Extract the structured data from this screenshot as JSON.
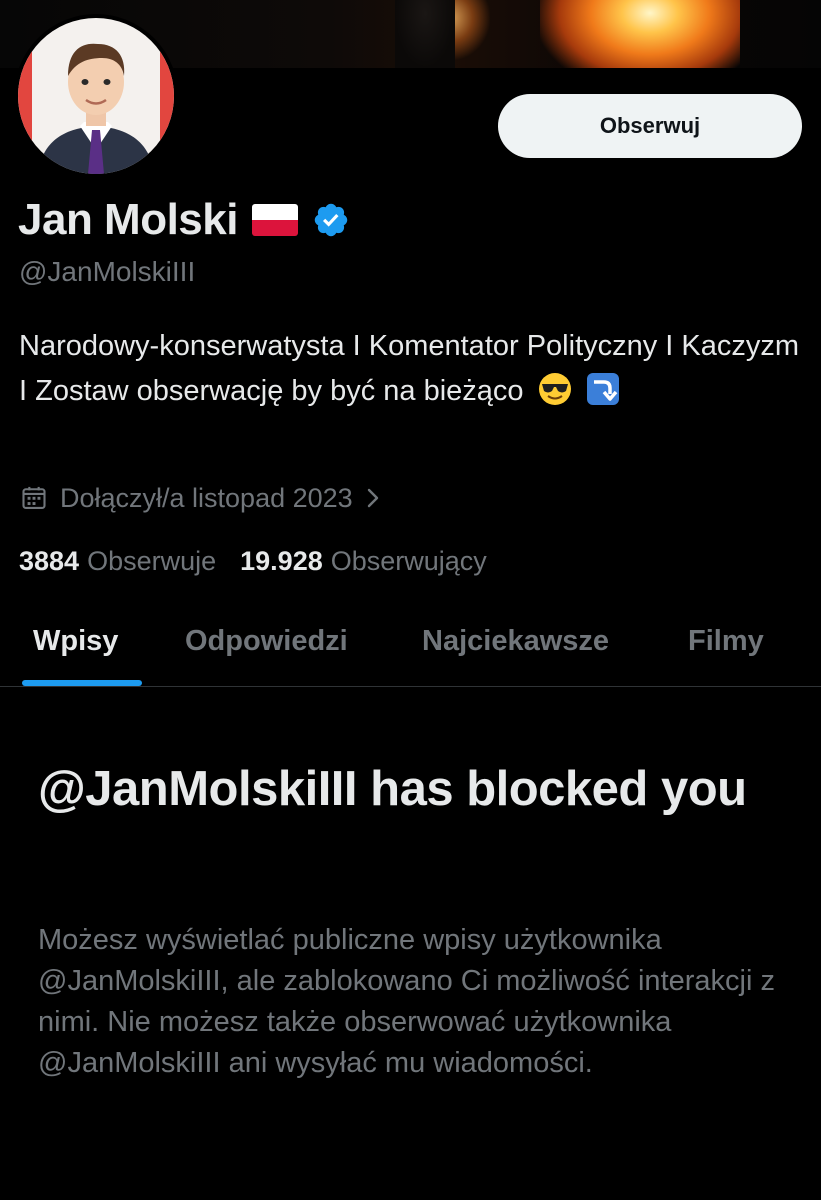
{
  "profile": {
    "display_name": "Jan Molski",
    "handle": "@JanMolskiIII",
    "bio": "Narodowy-konserwatysta I Komentator Polityczny I Kaczyzm I Zostaw obserwację by być na bieżąco",
    "bio_emojis": [
      "smiling-face-with-sunglasses-emoji",
      "right-arrow-curving-down-emoji"
    ],
    "flag": "poland-flag-icon",
    "verified": true,
    "joined": "Dołączył/a listopad 2023"
  },
  "actions": {
    "follow_label": "Obserwuj"
  },
  "stats": {
    "following_count": "3884",
    "following_label": "Obserwuje",
    "followers_count": "19.928",
    "followers_label": "Obserwujący"
  },
  "tabs": [
    {
      "label": "Wpisy",
      "active": true
    },
    {
      "label": "Odpowiedzi",
      "active": false
    },
    {
      "label": "Najciekawsze",
      "active": false
    },
    {
      "label": "Filmy",
      "active": false
    }
  ],
  "blocked": {
    "title": "@JanMolskiIII has blocked you",
    "description": "Możesz wyświetlać publiczne wpisy użytkownika @JanMolskiIII, ale zablokowano Ci możliwość interakcji z nimi. Nie możesz także obserwować użytkownika @JanMolskiIII ani wysyłać mu wiadomości."
  },
  "colors": {
    "background": "#000000",
    "text_primary": "#e7e9ea",
    "text_secondary": "#71767b",
    "accent": "#1d9bf0",
    "button_bg": "#eff3f4"
  }
}
